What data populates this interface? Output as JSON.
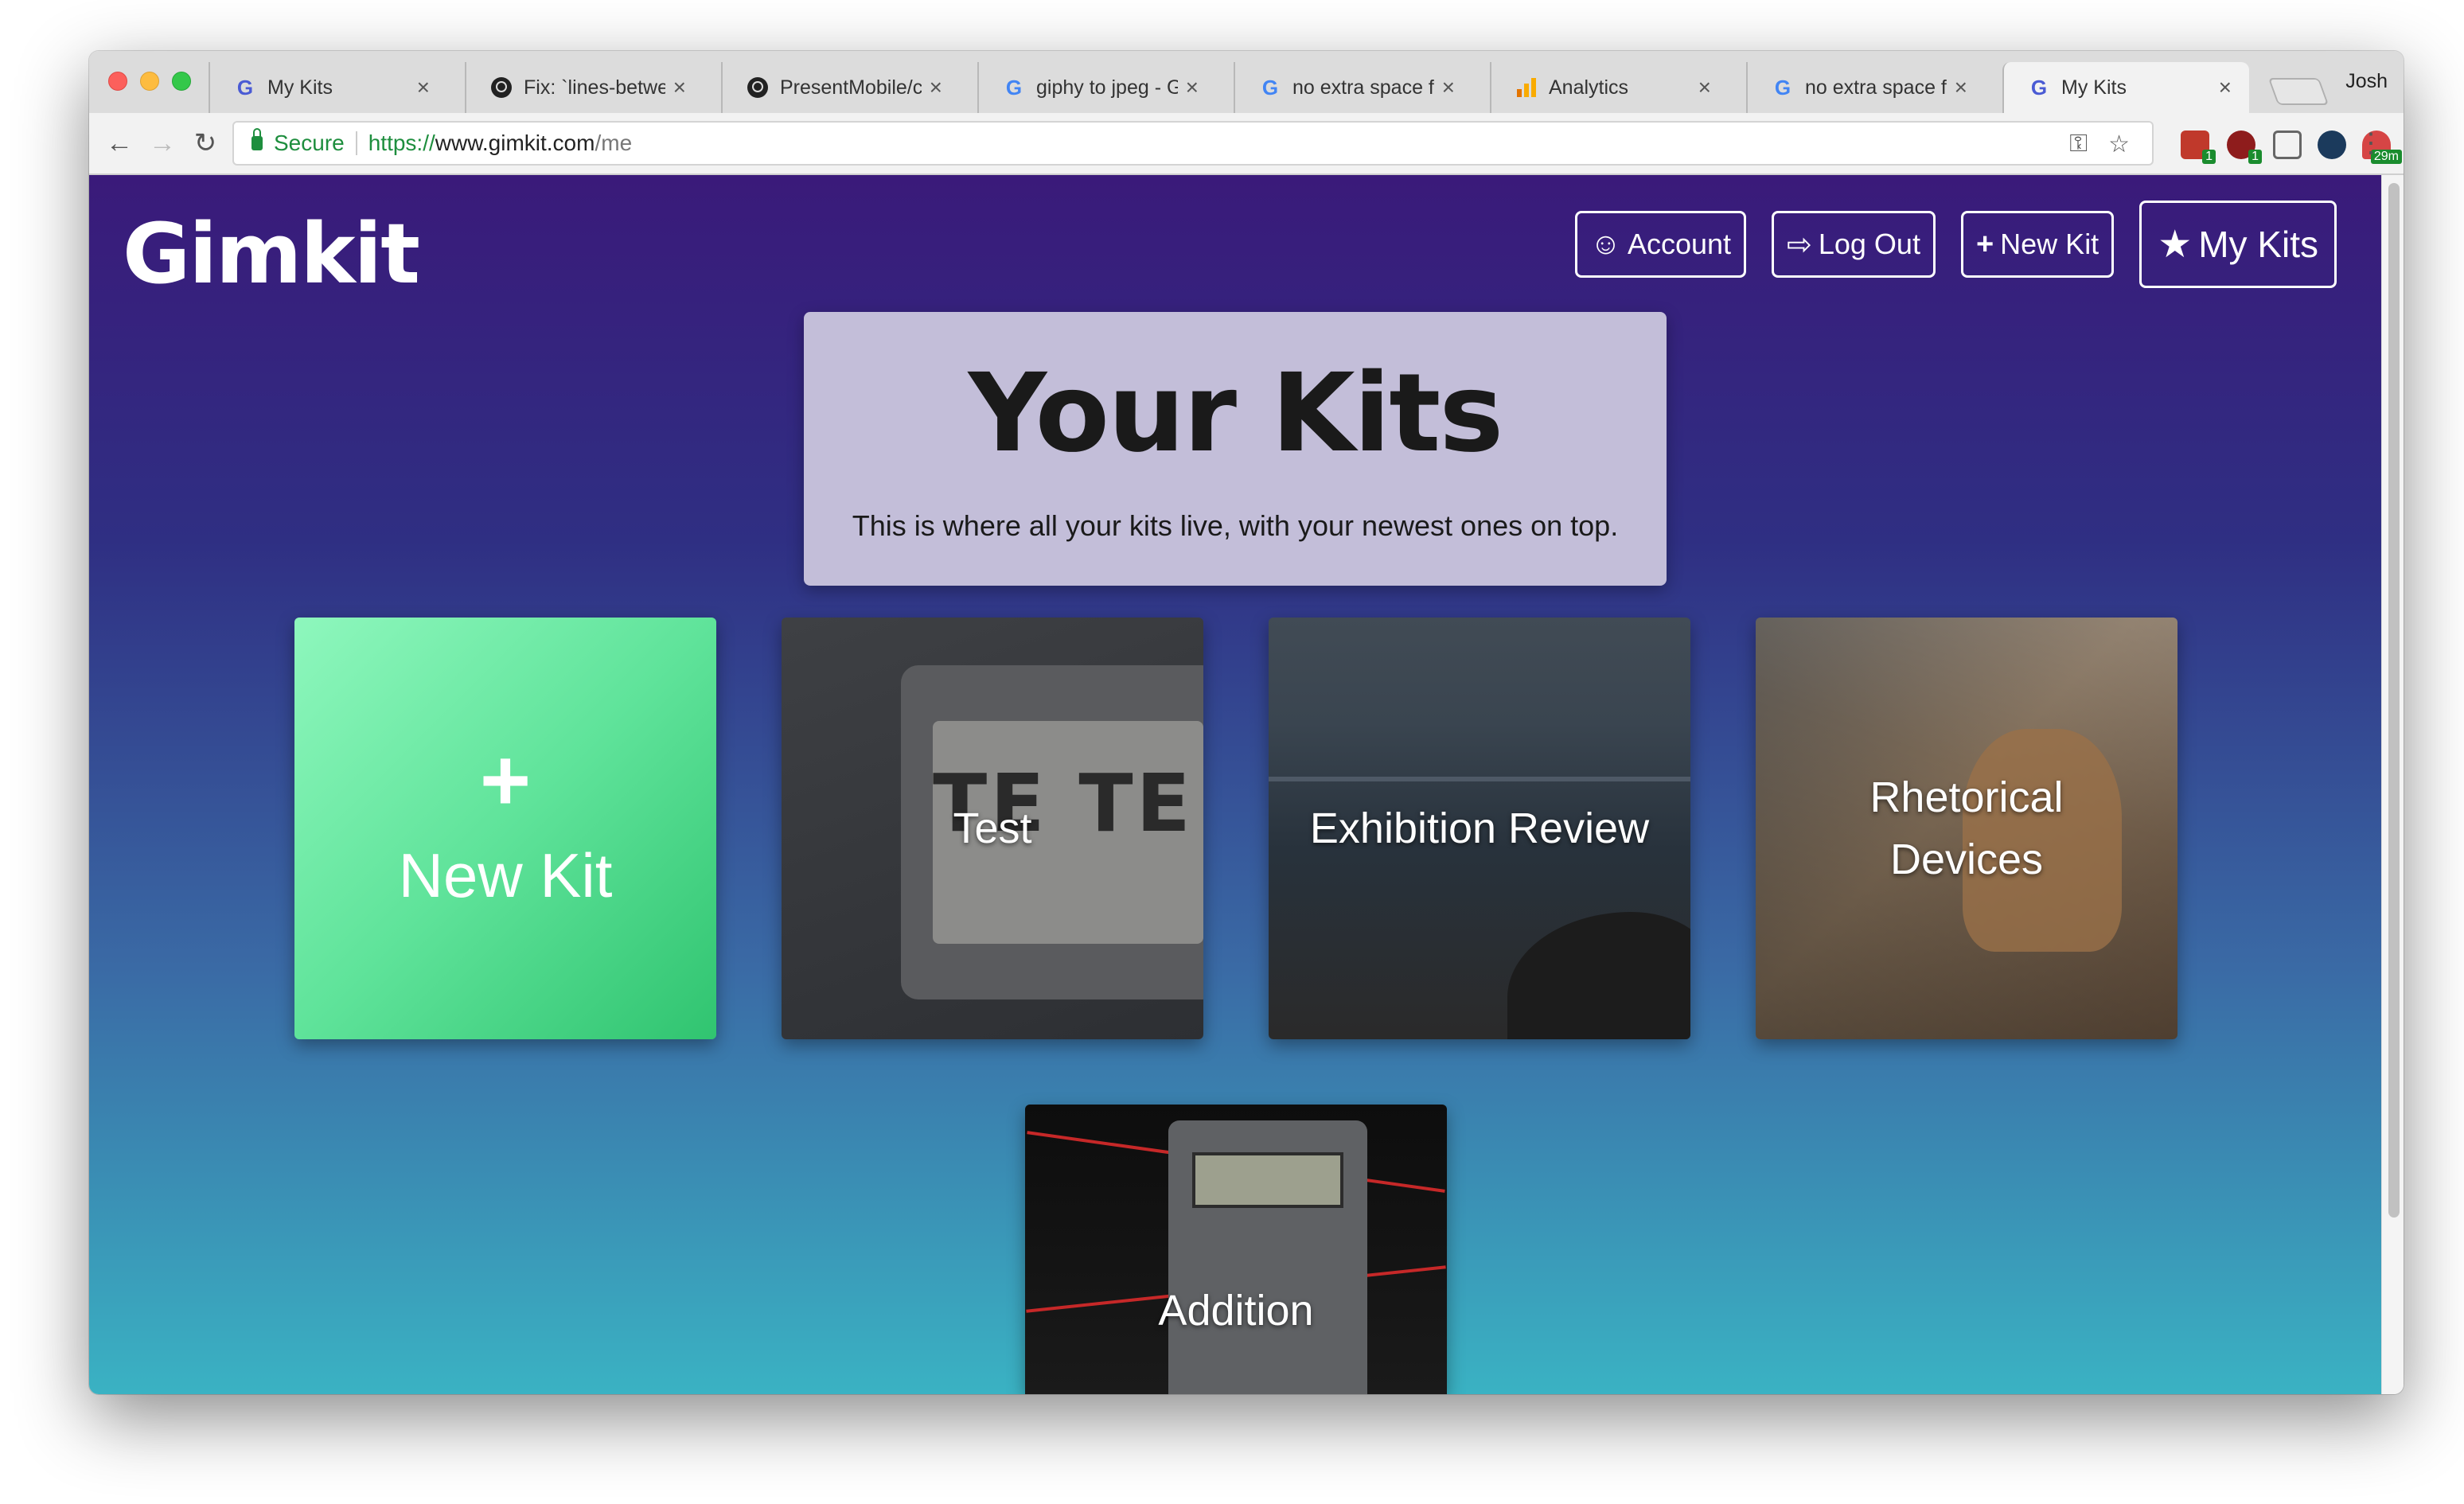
{
  "browser": {
    "tabs": [
      {
        "title": "My Kits",
        "icon": "google-g-icon",
        "active": false
      },
      {
        "title": "Fix: `lines-betwee",
        "icon": "github-icon",
        "active": false
      },
      {
        "title": "PresentMobile/col",
        "icon": "github-icon",
        "active": false
      },
      {
        "title": "giphy to jpeg - Go",
        "icon": "google-g-icon",
        "active": false
      },
      {
        "title": "no extra space fle",
        "icon": "google-g-icon",
        "active": false
      },
      {
        "title": "Analytics",
        "icon": "analytics-icon",
        "active": false
      },
      {
        "title": "no extra space fle",
        "icon": "google-g-icon",
        "active": false
      },
      {
        "title": "My Kits",
        "icon": "google-g-icon",
        "active": true
      }
    ],
    "profile_name": "Josh",
    "address": {
      "secure_label": "Secure",
      "scheme": "https://",
      "host": "www.gimkit.com",
      "path": "/me"
    },
    "extension_badges": [
      "1",
      "1",
      "29m"
    ]
  },
  "page": {
    "logo": "Gimkit",
    "nav": {
      "account": "Account",
      "logout": "Log Out",
      "new_kit": "New Kit",
      "my_kits": "My Kits"
    },
    "hero": {
      "title": "Your Kits",
      "subtitle": "This is where all your kits live, with your newest ones on top."
    },
    "kits": [
      {
        "label": "New Kit"
      },
      {
        "label": "Test"
      },
      {
        "label": "Exhibition Review"
      },
      {
        "label": "Rhetorical Devices"
      },
      {
        "label": "Addition"
      }
    ]
  },
  "colors": {
    "gradient_top": "#3a1a7a",
    "gradient_bottom": "#3ab2c3",
    "new_kit_green": "#4fdb8a",
    "hero_bg": "#c3bed9"
  }
}
